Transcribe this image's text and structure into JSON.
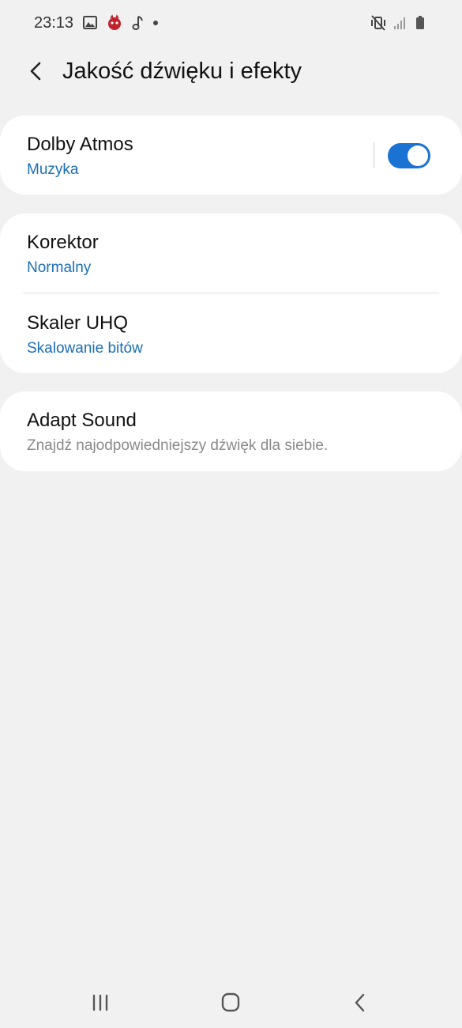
{
  "status_bar": {
    "time": "23:13",
    "left_icons": [
      "image-icon",
      "app-notification-icon",
      "music-note-icon",
      "dot-icon"
    ],
    "right_icons": [
      "vibrate-mute-icon",
      "signal-icon",
      "battery-icon"
    ]
  },
  "header": {
    "title": "Jakość dźwięku i efekty",
    "back_icon": "chevron-left-icon"
  },
  "cards": {
    "dolby": {
      "title": "Dolby Atmos",
      "subtitle": "Muzyka",
      "toggle_on": true
    },
    "equalizer": {
      "title": "Korektor",
      "subtitle": "Normalny"
    },
    "uhq": {
      "title": "Skaler UHQ",
      "subtitle": "Skalowanie bitów"
    },
    "adapt": {
      "title": "Adapt Sound",
      "subtitle": "Znajdź najodpowiedniejszy dźwięk dla siebie."
    }
  },
  "nav_bar": {
    "buttons": [
      "recent-apps-icon",
      "home-icon",
      "back-icon"
    ]
  },
  "colors": {
    "background": "#f1f1f1",
    "card": "#ffffff",
    "accent": "#1a73d2",
    "subtitle_blue": "#1a6fb5",
    "subtitle_gray": "#8a8a8a"
  }
}
